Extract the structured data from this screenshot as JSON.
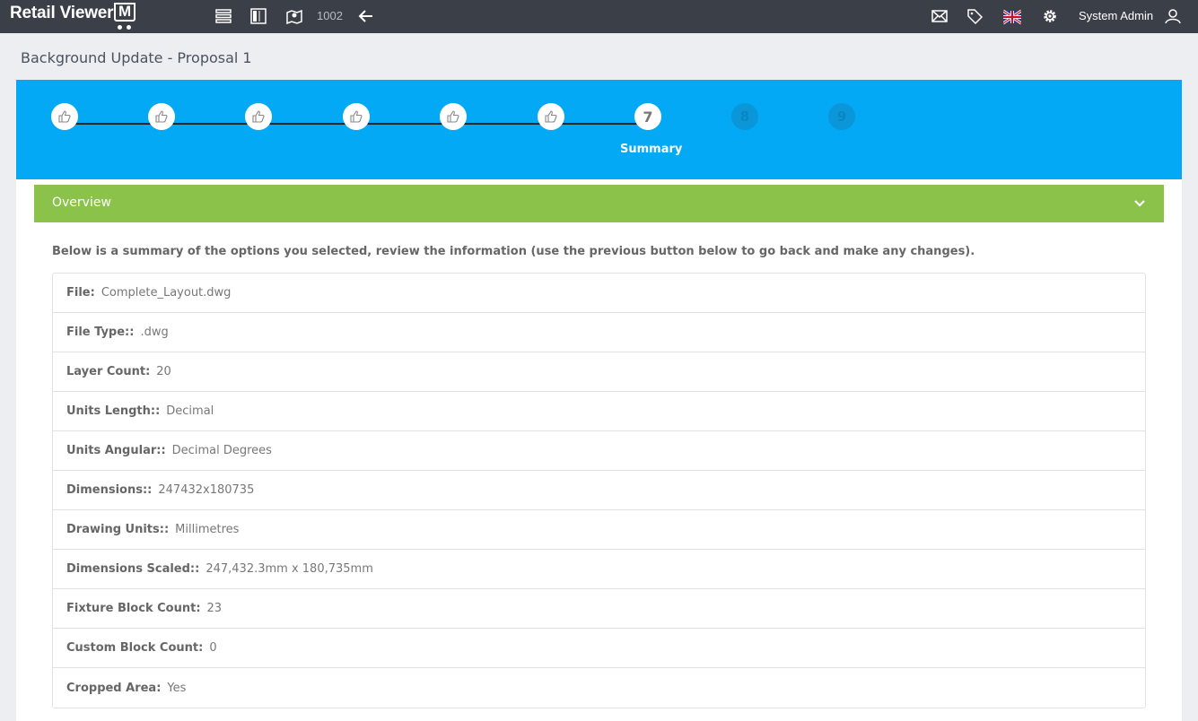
{
  "app": {
    "logo_text": "Retail Viewer",
    "logo_badge": "M"
  },
  "topbar": {
    "record_number": "1002",
    "user_name": "System Admin"
  },
  "page": {
    "title": "Background Update - Proposal 1"
  },
  "wizard": {
    "current_step": 7,
    "steps": [
      {
        "state": "done",
        "label": ""
      },
      {
        "state": "done",
        "label": ""
      },
      {
        "state": "done",
        "label": ""
      },
      {
        "state": "done",
        "label": ""
      },
      {
        "state": "done",
        "label": ""
      },
      {
        "state": "done",
        "label": ""
      },
      {
        "state": "current",
        "number": "7",
        "label": "Summary"
      },
      {
        "state": "todo",
        "number": "8",
        "label": ""
      },
      {
        "state": "todo",
        "number": "9",
        "label": ""
      }
    ]
  },
  "overview": {
    "title": "Overview",
    "intro": "Below is a summary of the options you selected, review the information (use the previous button below to go back and make any changes).",
    "rows": [
      {
        "label": "File:",
        "value": "Complete_Layout.dwg"
      },
      {
        "label": "File Type::",
        "value": ".dwg"
      },
      {
        "label": "Layer Count:",
        "value": "20"
      },
      {
        "label": "Units Length::",
        "value": "Decimal"
      },
      {
        "label": "Units Angular::",
        "value": "Decimal Degrees"
      },
      {
        "label": "Dimensions::",
        "value": "247432x180735"
      },
      {
        "label": "Drawing Units::",
        "value": "Millimetres"
      },
      {
        "label": "Dimensions Scaled::",
        "value": "247,432.3mm x 180,735mm"
      },
      {
        "label": "Fixture Block Count:",
        "value": "23"
      },
      {
        "label": "Custom Block Count:",
        "value": "0"
      },
      {
        "label": "Cropped Area:",
        "value": "Yes"
      }
    ]
  },
  "colors": {
    "topbar": "#3a3f48",
    "wizard": "#03a9f4",
    "overview": "#8bc34a"
  }
}
